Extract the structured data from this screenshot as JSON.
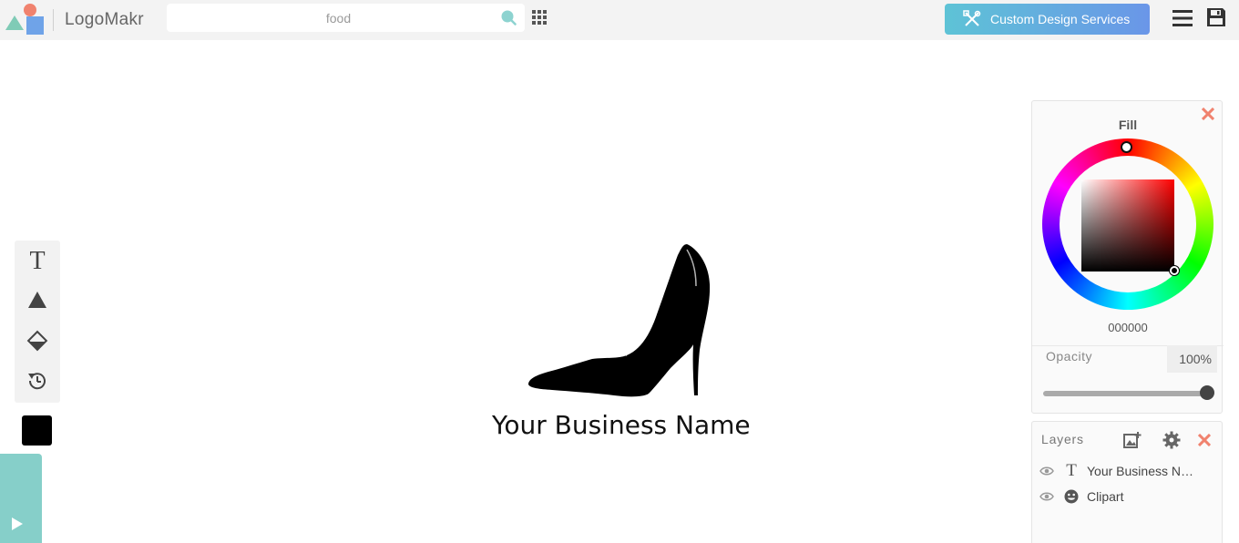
{
  "app": {
    "name": "LogoMakr"
  },
  "topbar": {
    "search_value": "food",
    "custom_design_label": "Custom Design Services"
  },
  "canvas": {
    "business_name": "Your Business Name"
  },
  "fill_panel": {
    "title": "Fill",
    "hex": "000000",
    "opacity_label": "Opacity",
    "opacity_value": "100%",
    "opacity_fraction": 1.0
  },
  "layers_panel": {
    "title": "Layers",
    "layers": [
      {
        "label": "Your Business N…",
        "type": "text"
      },
      {
        "label": "Clipart",
        "type": "clipart"
      }
    ]
  },
  "colors": {
    "accent_gradient_start": "#5ec3d6",
    "accent_gradient_end": "#6a96e8",
    "close_red": "#f0826e",
    "preview_tab": "#86cfc9",
    "selected_fill": "#000000"
  },
  "icons": {
    "search": "search-icon",
    "apps": "grid-icon",
    "custom_design": "tools-icon",
    "menu": "hamburger-icon",
    "save": "save-icon",
    "text_tool": "text-tool-icon",
    "shape_tool": "triangle-icon",
    "background_tool": "background-icon",
    "history_tool": "history-icon",
    "preview": "play-icon"
  }
}
